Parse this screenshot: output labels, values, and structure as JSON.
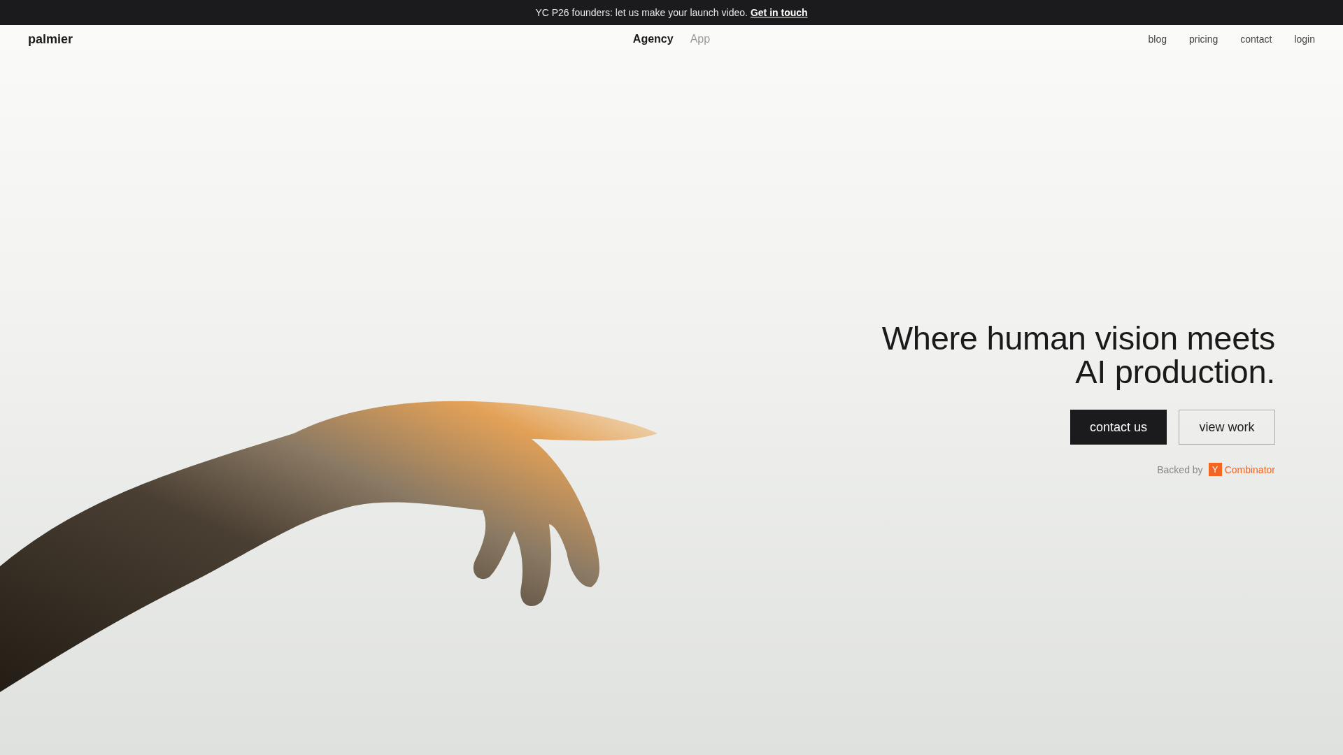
{
  "banner": {
    "text": "YC P26 founders: let us make your launch video.",
    "link": "Get in touch"
  },
  "nav": {
    "logo": "palmier",
    "modes": [
      {
        "label": "Agency",
        "selected": true
      },
      {
        "label": "App",
        "selected": false
      }
    ],
    "links": [
      "blog",
      "pricing",
      "contact",
      "login"
    ]
  },
  "hero": {
    "headline_lines": [
      "Where human vision meets",
      "AI production."
    ],
    "buttons": [
      {
        "label": "contact us",
        "kind": "primary"
      },
      {
        "label": "view work",
        "kind": "secondary"
      }
    ],
    "backed": {
      "prefix": "Backed by",
      "badge": "Y",
      "name": "Combinator"
    }
  }
}
